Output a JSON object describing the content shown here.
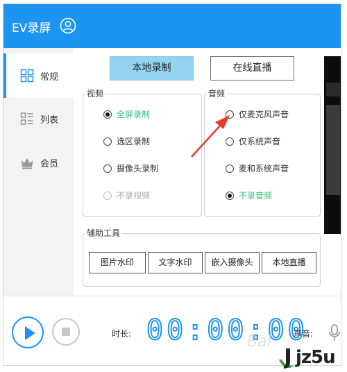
{
  "app": {
    "title": "EV录屏"
  },
  "sidebar": {
    "items": [
      {
        "label": "常规",
        "icon": "grid-icon"
      },
      {
        "label": "列表",
        "icon": "list-icon"
      },
      {
        "label": "会员",
        "icon": "crown-icon"
      }
    ],
    "active": "常规"
  },
  "mode_tabs": {
    "local": "本地录制",
    "live": "在线直播"
  },
  "video": {
    "title": "视频",
    "options": [
      "全屏录制",
      "选区录制",
      "摄像头录制",
      "不录视频"
    ],
    "selected": "全屏录制"
  },
  "audio": {
    "title": "音频",
    "options": [
      "仅麦克风声音",
      "仅系统声音",
      "麦和系统声音",
      "不录音频"
    ],
    "selected": "不录音频"
  },
  "tools": {
    "title": "辅助工具",
    "buttons": [
      "图片水印",
      "文字水印",
      "嵌入摄像头",
      "本地直播"
    ]
  },
  "bottom": {
    "duration_label": "时长:",
    "timer": "00:00:00",
    "sound_label": "声音:"
  },
  "watermark": {
    "baidu": "Bai",
    "site": "jz5u"
  },
  "colors": {
    "accent": "#1d95f0",
    "selected_text": "#2ec07a",
    "annotation": "#e53a2e"
  }
}
